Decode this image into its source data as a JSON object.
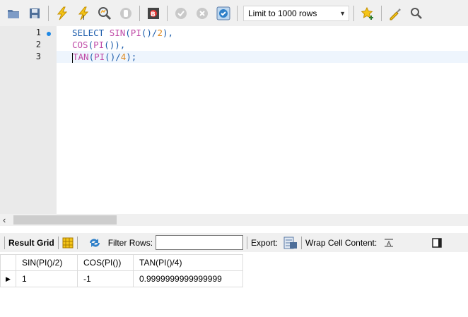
{
  "toolbar": {
    "icons": [
      "open-file-icon",
      "save-icon",
      "execute-icon",
      "execute-current-icon",
      "explain-icon",
      "stop-icon",
      "toggle-stop-on-error-icon",
      "commit-icon",
      "rollback-icon",
      "autocommit-icon",
      "beautify-icon",
      "find-icon"
    ],
    "limit_label": "Limit to 1000 rows"
  },
  "editor": {
    "lines": [
      {
        "number": "1",
        "text": [
          "SELECT ",
          "SIN",
          "(",
          "PI",
          "()/",
          "2",
          "),"
        ]
      },
      {
        "number": "2",
        "text": [
          "COS",
          "(",
          "PI",
          "()),"
        ]
      },
      {
        "number": "3",
        "text": [
          "TAN",
          "(",
          "PI",
          "()/",
          "4",
          ");"
        ]
      }
    ]
  },
  "result_bar": {
    "result_grid_label": "Result Grid",
    "filter_label": "Filter Rows:",
    "filter_value": "",
    "export_label": "Export:",
    "wrap_label": "Wrap Cell Content:"
  },
  "grid": {
    "columns": [
      "SIN(PI()/2)",
      "COS(PI())",
      "TAN(PI()/4)"
    ],
    "rows": [
      [
        "1",
        "-1",
        "0.9999999999999999"
      ]
    ]
  },
  "colors": {
    "keyword": "#1c5cab",
    "function": "#c04ca8",
    "number": "#e08a1e",
    "current_line": "#eef5fd"
  }
}
